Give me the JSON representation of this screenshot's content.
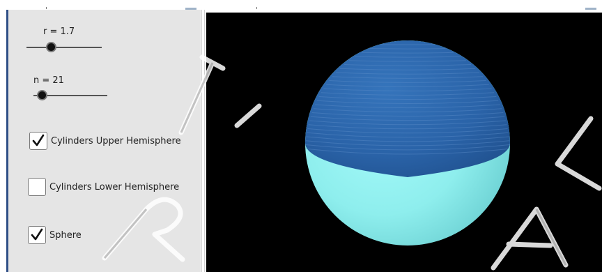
{
  "sliders": [
    {
      "label": "r = 1.7",
      "value": 1.7
    },
    {
      "label": "n = 21",
      "value": 21
    }
  ],
  "checkboxes": [
    {
      "label": "Cylinders Upper Hemisphere",
      "checked": true
    },
    {
      "label": "Cylinders Lower Hemisphere",
      "checked": false
    },
    {
      "label": "Sphere",
      "checked": true
    }
  ],
  "colors": {
    "panel_bg": "#e5e5e5",
    "view_bg": "#000000",
    "upper_hemisphere": "#2a63a8",
    "lower_hemisphere": "#8ff0ef",
    "accent_bar": "#2f4f86"
  },
  "watermark": "TRIAL"
}
